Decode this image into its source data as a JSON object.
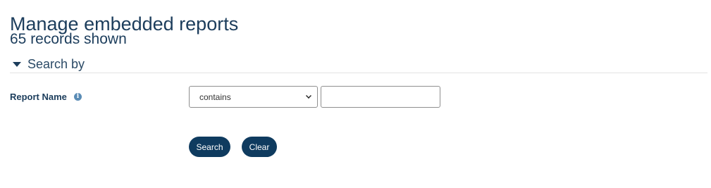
{
  "header": {
    "title": "Manage embedded reports",
    "records_shown": "65 records shown"
  },
  "search": {
    "section_label": "Search by",
    "fields": [
      {
        "label": "Report Name",
        "help_icon": "info-icon",
        "operator_selected": "contains",
        "value": "",
        "placeholder": ""
      }
    ],
    "search_button_label": "Search",
    "clear_button_label": "Clear"
  },
  "colors": {
    "heading": "#1c3d5c",
    "button_bg": "#0f3b5f",
    "button_text": "#ffffff",
    "info_icon": "#5a8cb5"
  }
}
